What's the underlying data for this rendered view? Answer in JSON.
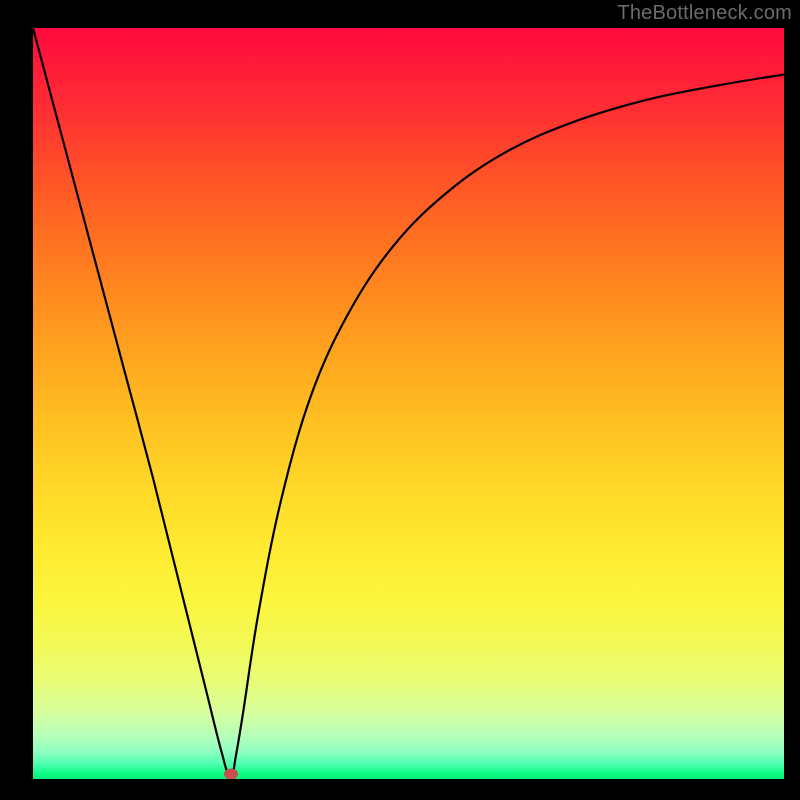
{
  "watermark": "TheBottleneck.com",
  "chart_data": {
    "type": "line",
    "title": "",
    "xlabel": "",
    "ylabel": "",
    "xlim": [
      0,
      100
    ],
    "ylim": [
      0,
      100
    ],
    "grid": false,
    "legend": false,
    "marker": {
      "x": 26.3,
      "y": 0.6,
      "color": "#c94f4f"
    },
    "series": [
      {
        "name": "curve",
        "color": "#000000",
        "x": [
          0,
          4,
          8,
          12,
          16,
          20,
          23,
          25,
          26.3,
          27,
          28,
          30,
          33,
          37,
          42,
          48,
          55,
          63,
          72,
          82,
          92,
          100
        ],
        "y": [
          100,
          85,
          70,
          55,
          40,
          24,
          12,
          4,
          0,
          3,
          9,
          22,
          37,
          51,
          62,
          71,
          78,
          83.5,
          87.5,
          90.5,
          92.5,
          93.8
        ]
      }
    ],
    "background_gradient": {
      "top": "#ff0a3e",
      "bottom": "#00f07a"
    }
  }
}
